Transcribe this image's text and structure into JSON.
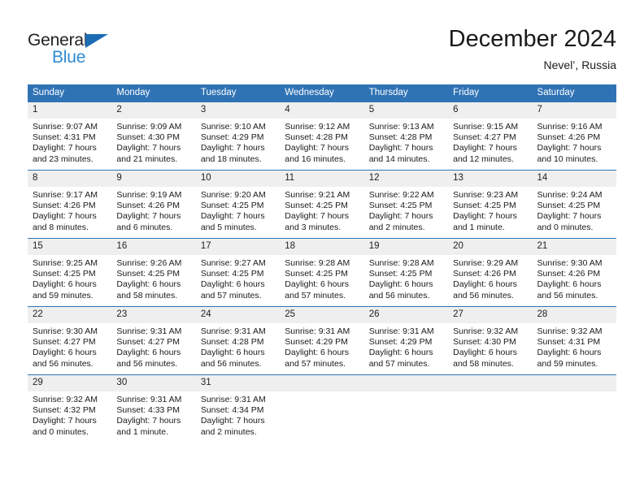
{
  "brand": {
    "name_part1": "General",
    "name_part2": "Blue",
    "triangle_icon": "triangle-icon",
    "colors": {
      "dark": "#231f20",
      "blue": "#2e8bd4",
      "triangle": "#1c6cb4"
    }
  },
  "header": {
    "title": "December 2024",
    "subtitle": "Nevel’, Russia"
  },
  "theme": {
    "header_blue": "#3073b5",
    "row_border_blue": "#2e74b5",
    "daynum_band": "#efefef",
    "text": "#1a1a1a"
  },
  "weekday_headers": [
    "Sunday",
    "Monday",
    "Tuesday",
    "Wednesday",
    "Thursday",
    "Friday",
    "Saturday"
  ],
  "weeks": [
    [
      {
        "day": "1",
        "sunrise": "Sunrise: 9:07 AM",
        "sunset": "Sunset: 4:31 PM",
        "daylight1": "Daylight: 7 hours",
        "daylight2": "and 23 minutes."
      },
      {
        "day": "2",
        "sunrise": "Sunrise: 9:09 AM",
        "sunset": "Sunset: 4:30 PM",
        "daylight1": "Daylight: 7 hours",
        "daylight2": "and 21 minutes."
      },
      {
        "day": "3",
        "sunrise": "Sunrise: 9:10 AM",
        "sunset": "Sunset: 4:29 PM",
        "daylight1": "Daylight: 7 hours",
        "daylight2": "and 18 minutes."
      },
      {
        "day": "4",
        "sunrise": "Sunrise: 9:12 AM",
        "sunset": "Sunset: 4:28 PM",
        "daylight1": "Daylight: 7 hours",
        "daylight2": "and 16 minutes."
      },
      {
        "day": "5",
        "sunrise": "Sunrise: 9:13 AM",
        "sunset": "Sunset: 4:28 PM",
        "daylight1": "Daylight: 7 hours",
        "daylight2": "and 14 minutes."
      },
      {
        "day": "6",
        "sunrise": "Sunrise: 9:15 AM",
        "sunset": "Sunset: 4:27 PM",
        "daylight1": "Daylight: 7 hours",
        "daylight2": "and 12 minutes."
      },
      {
        "day": "7",
        "sunrise": "Sunrise: 9:16 AM",
        "sunset": "Sunset: 4:26 PM",
        "daylight1": "Daylight: 7 hours",
        "daylight2": "and 10 minutes."
      }
    ],
    [
      {
        "day": "8",
        "sunrise": "Sunrise: 9:17 AM",
        "sunset": "Sunset: 4:26 PM",
        "daylight1": "Daylight: 7 hours",
        "daylight2": "and 8 minutes."
      },
      {
        "day": "9",
        "sunrise": "Sunrise: 9:19 AM",
        "sunset": "Sunset: 4:26 PM",
        "daylight1": "Daylight: 7 hours",
        "daylight2": "and 6 minutes."
      },
      {
        "day": "10",
        "sunrise": "Sunrise: 9:20 AM",
        "sunset": "Sunset: 4:25 PM",
        "daylight1": "Daylight: 7 hours",
        "daylight2": "and 5 minutes."
      },
      {
        "day": "11",
        "sunrise": "Sunrise: 9:21 AM",
        "sunset": "Sunset: 4:25 PM",
        "daylight1": "Daylight: 7 hours",
        "daylight2": "and 3 minutes."
      },
      {
        "day": "12",
        "sunrise": "Sunrise: 9:22 AM",
        "sunset": "Sunset: 4:25 PM",
        "daylight1": "Daylight: 7 hours",
        "daylight2": "and 2 minutes."
      },
      {
        "day": "13",
        "sunrise": "Sunrise: 9:23 AM",
        "sunset": "Sunset: 4:25 PM",
        "daylight1": "Daylight: 7 hours",
        "daylight2": "and 1 minute."
      },
      {
        "day": "14",
        "sunrise": "Sunrise: 9:24 AM",
        "sunset": "Sunset: 4:25 PM",
        "daylight1": "Daylight: 7 hours",
        "daylight2": "and 0 minutes."
      }
    ],
    [
      {
        "day": "15",
        "sunrise": "Sunrise: 9:25 AM",
        "sunset": "Sunset: 4:25 PM",
        "daylight1": "Daylight: 6 hours",
        "daylight2": "and 59 minutes."
      },
      {
        "day": "16",
        "sunrise": "Sunrise: 9:26 AM",
        "sunset": "Sunset: 4:25 PM",
        "daylight1": "Daylight: 6 hours",
        "daylight2": "and 58 minutes."
      },
      {
        "day": "17",
        "sunrise": "Sunrise: 9:27 AM",
        "sunset": "Sunset: 4:25 PM",
        "daylight1": "Daylight: 6 hours",
        "daylight2": "and 57 minutes."
      },
      {
        "day": "18",
        "sunrise": "Sunrise: 9:28 AM",
        "sunset": "Sunset: 4:25 PM",
        "daylight1": "Daylight: 6 hours",
        "daylight2": "and 57 minutes."
      },
      {
        "day": "19",
        "sunrise": "Sunrise: 9:28 AM",
        "sunset": "Sunset: 4:25 PM",
        "daylight1": "Daylight: 6 hours",
        "daylight2": "and 56 minutes."
      },
      {
        "day": "20",
        "sunrise": "Sunrise: 9:29 AM",
        "sunset": "Sunset: 4:26 PM",
        "daylight1": "Daylight: 6 hours",
        "daylight2": "and 56 minutes."
      },
      {
        "day": "21",
        "sunrise": "Sunrise: 9:30 AM",
        "sunset": "Sunset: 4:26 PM",
        "daylight1": "Daylight: 6 hours",
        "daylight2": "and 56 minutes."
      }
    ],
    [
      {
        "day": "22",
        "sunrise": "Sunrise: 9:30 AM",
        "sunset": "Sunset: 4:27 PM",
        "daylight1": "Daylight: 6 hours",
        "daylight2": "and 56 minutes."
      },
      {
        "day": "23",
        "sunrise": "Sunrise: 9:31 AM",
        "sunset": "Sunset: 4:27 PM",
        "daylight1": "Daylight: 6 hours",
        "daylight2": "and 56 minutes."
      },
      {
        "day": "24",
        "sunrise": "Sunrise: 9:31 AM",
        "sunset": "Sunset: 4:28 PM",
        "daylight1": "Daylight: 6 hours",
        "daylight2": "and 56 minutes."
      },
      {
        "day": "25",
        "sunrise": "Sunrise: 9:31 AM",
        "sunset": "Sunset: 4:29 PM",
        "daylight1": "Daylight: 6 hours",
        "daylight2": "and 57 minutes."
      },
      {
        "day": "26",
        "sunrise": "Sunrise: 9:31 AM",
        "sunset": "Sunset: 4:29 PM",
        "daylight1": "Daylight: 6 hours",
        "daylight2": "and 57 minutes."
      },
      {
        "day": "27",
        "sunrise": "Sunrise: 9:32 AM",
        "sunset": "Sunset: 4:30 PM",
        "daylight1": "Daylight: 6 hours",
        "daylight2": "and 58 minutes."
      },
      {
        "day": "28",
        "sunrise": "Sunrise: 9:32 AM",
        "sunset": "Sunset: 4:31 PM",
        "daylight1": "Daylight: 6 hours",
        "daylight2": "and 59 minutes."
      }
    ],
    [
      {
        "day": "29",
        "sunrise": "Sunrise: 9:32 AM",
        "sunset": "Sunset: 4:32 PM",
        "daylight1": "Daylight: 7 hours",
        "daylight2": "and 0 minutes."
      },
      {
        "day": "30",
        "sunrise": "Sunrise: 9:31 AM",
        "sunset": "Sunset: 4:33 PM",
        "daylight1": "Daylight: 7 hours",
        "daylight2": "and 1 minute."
      },
      {
        "day": "31",
        "sunrise": "Sunrise: 9:31 AM",
        "sunset": "Sunset: 4:34 PM",
        "daylight1": "Daylight: 7 hours",
        "daylight2": "and 2 minutes."
      },
      {
        "day": "",
        "sunrise": "",
        "sunset": "",
        "daylight1": "",
        "daylight2": ""
      },
      {
        "day": "",
        "sunrise": "",
        "sunset": "",
        "daylight1": "",
        "daylight2": ""
      },
      {
        "day": "",
        "sunrise": "",
        "sunset": "",
        "daylight1": "",
        "daylight2": ""
      },
      {
        "day": "",
        "sunrise": "",
        "sunset": "",
        "daylight1": "",
        "daylight2": ""
      }
    ]
  ]
}
